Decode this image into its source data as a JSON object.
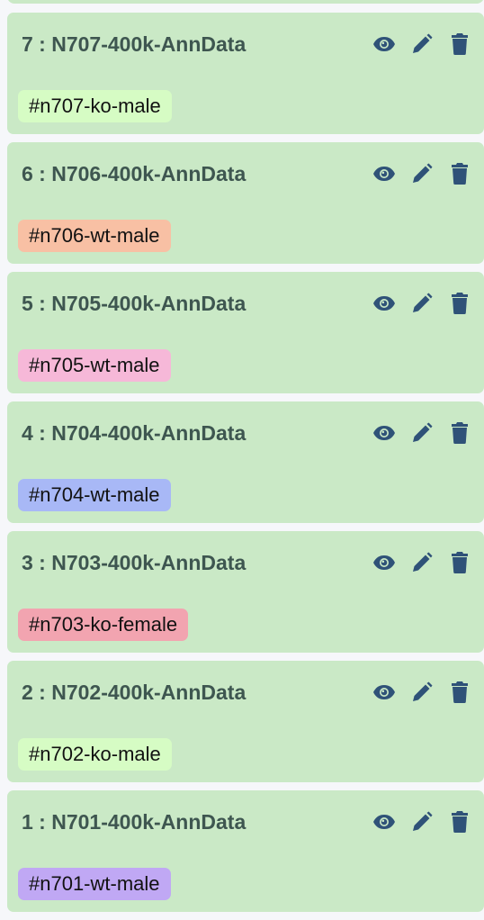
{
  "colors": {
    "card": "#cae9c6",
    "title": "#3e5650",
    "icon": "#2f5278"
  },
  "datasets": [
    {
      "title": "7 : N707-400k-AnnData",
      "tag": "#n707-ko-male",
      "tag_color": "#d6fcc4"
    },
    {
      "title": "6 : N706-400k-AnnData",
      "tag": "#n706-wt-male",
      "tag_color": "#f8c0a4"
    },
    {
      "title": "5 : N705-400k-AnnData",
      "tag": "#n705-wt-male",
      "tag_color": "#f6b8d8"
    },
    {
      "title": "4 : N704-400k-AnnData",
      "tag": "#n704-wt-male",
      "tag_color": "#a8b8f6"
    },
    {
      "title": "3 : N703-400k-AnnData",
      "tag": "#n703-ko-female",
      "tag_color": "#f2a4b0"
    },
    {
      "title": "2 : N702-400k-AnnData",
      "tag": "#n702-ko-male",
      "tag_color": "#d6fcc4"
    },
    {
      "title": "1 : N701-400k-AnnData",
      "tag": "#n701-wt-male",
      "tag_color": "#c0a8f4"
    }
  ]
}
